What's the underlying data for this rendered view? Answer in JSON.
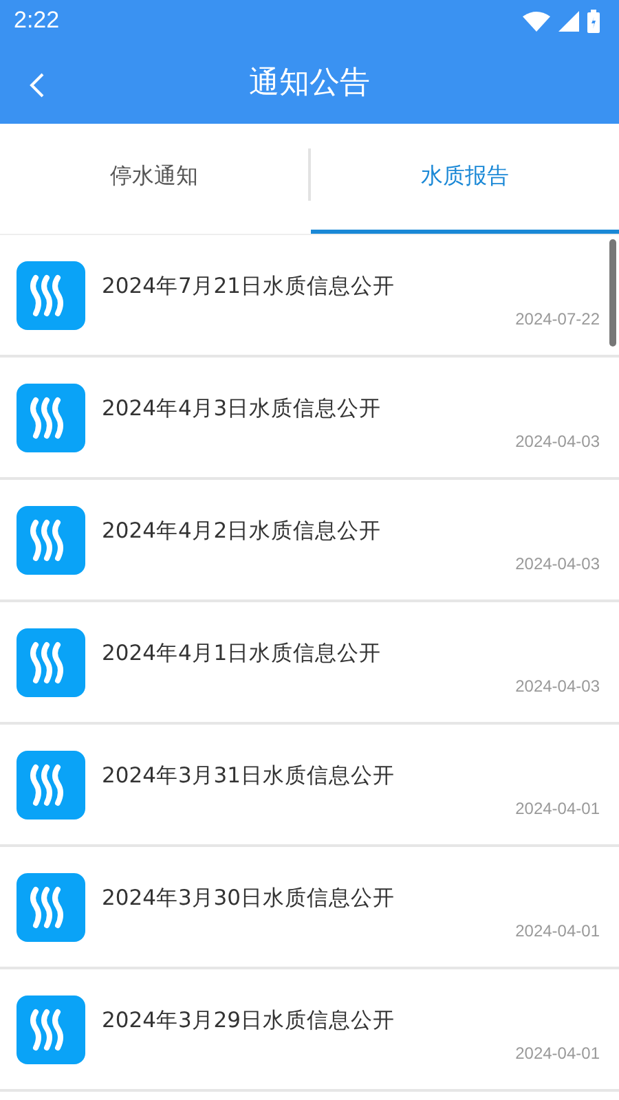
{
  "status_bar": {
    "time": "2:22"
  },
  "header": {
    "title": "通知公告"
  },
  "tabs": [
    {
      "label": "停水通知",
      "selected": false
    },
    {
      "label": "水质报告",
      "selected": true
    }
  ],
  "reports": [
    {
      "title": "2024年7月21日水质信息公开",
      "date": "2024-07-22"
    },
    {
      "title": "2024年4月3日水质信息公开",
      "date": "2024-04-03"
    },
    {
      "title": "2024年4月2日水质信息公开",
      "date": "2024-04-03"
    },
    {
      "title": "2024年4月1日水质信息公开",
      "date": "2024-04-03"
    },
    {
      "title": "2024年3月31日水质信息公开",
      "date": "2024-04-01"
    },
    {
      "title": "2024年3月30日水质信息公开",
      "date": "2024-04-01"
    },
    {
      "title": "2024年3月29日水质信息公开",
      "date": "2024-04-01"
    }
  ]
}
